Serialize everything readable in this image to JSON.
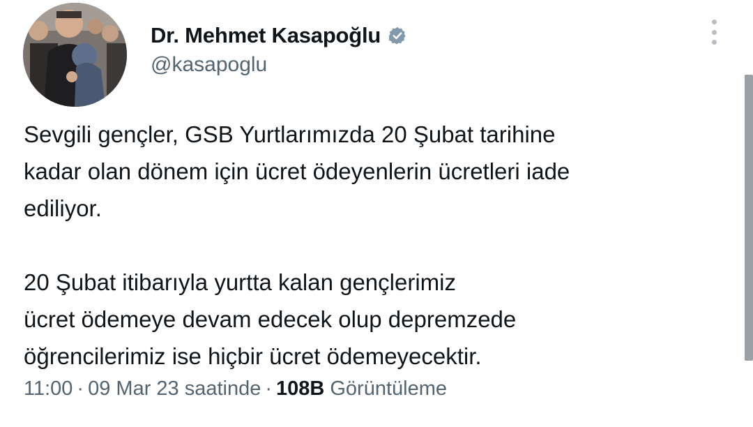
{
  "author": {
    "display_name": "Dr. Mehmet Kasapoğlu",
    "handle": "@kasapoglu",
    "verified_icon": "verified-badge",
    "verified_color": "#829aab"
  },
  "tweet": {
    "paragraphs": [
      [
        "Sevgili gençler, GSB Yurtlarımızda 20 Şubat tarihine",
        "kadar olan dönem için ücret ödeyenlerin ücretleri iade",
        "ediliyor."
      ],
      [
        "20 Şubat itibarıyla yurtta kalan gençlerimiz",
        "ücret ödemeye devam edecek olup depremzede",
        "öğrencilerimiz ise hiçbir ücret ödemeyecektir."
      ]
    ]
  },
  "meta": {
    "time": "11:00",
    "dot": "·",
    "date": "09 Mar 23 saatinde",
    "views_count": "108B",
    "views_label": "Görüntüleme"
  },
  "colors": {
    "text_primary": "#0f1419",
    "text_secondary": "#536471",
    "background": "#ffffff"
  }
}
